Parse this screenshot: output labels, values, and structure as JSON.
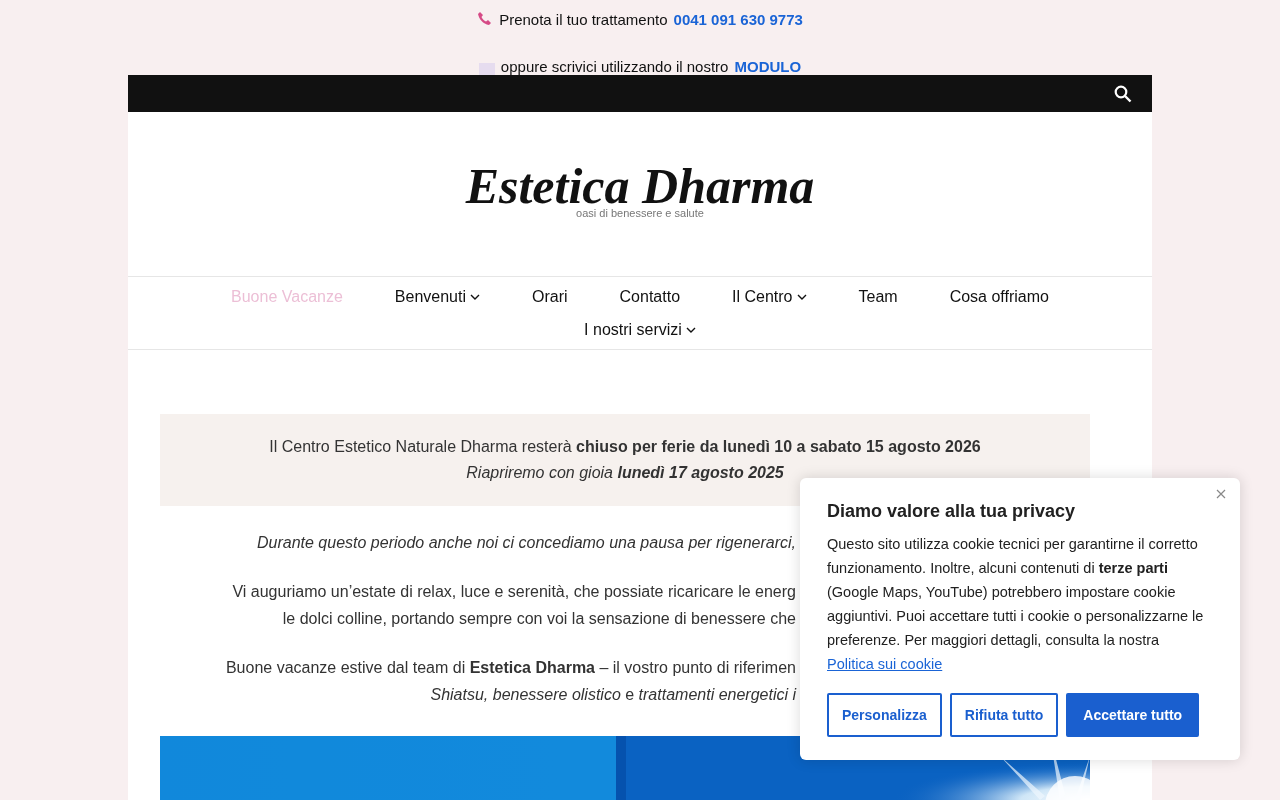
{
  "contact_bar": {
    "phone_label": "Prenota il tuo trattamento",
    "phone": "0041 091 630 9773",
    "form_label": "oppure scrivici utilizzando il nostro",
    "form_link": "MODULO"
  },
  "site": {
    "title": "Estetica Dharma",
    "tagline": "oasi di benessere e salute"
  },
  "nav": [
    {
      "label": "Buone Vacanze",
      "selected": true,
      "has_submenu": false
    },
    {
      "label": "Benvenuti",
      "selected": false,
      "has_submenu": true
    },
    {
      "label": "Orari",
      "selected": false,
      "has_submenu": false
    },
    {
      "label": "Contatto",
      "selected": false,
      "has_submenu": false
    },
    {
      "label": "Il Centro",
      "selected": false,
      "has_submenu": true
    },
    {
      "label": "Team",
      "selected": false,
      "has_submenu": false
    },
    {
      "label": "Cosa offriamo",
      "selected": false,
      "has_submenu": false
    },
    {
      "label": "I nostri servizi",
      "selected": false,
      "has_submenu": true
    }
  ],
  "notice": {
    "lines": [
      {
        "text": "Il Centro Estetico Naturale Dharma resterà **chiuso per ferie da lunedì 10 a sabato 15 agosto 2026**",
        "italic": false
      },
      {
        "text": "Riapriremo con gioia **lunedì 17 agosto 2025**",
        "italic": true
      }
    ]
  },
  "paragraphs": [
    {
      "lines": [
        {
          "text": "Durante questo periodo anche noi ci concediamo una pausa per rigenerarci,",
          "italic": true
        }
      ]
    },
    {
      "lines": [
        {
          "text": "Vi auguriamo un’estate di relax, luce e serenità, che possiate ricaricare le energ",
          "italic": false
        },
        {
          "text": "le dolci colline, portando sempre con voi la sensazione di benessere che",
          "italic": false
        }
      ]
    },
    {
      "lines": [
        {
          "text": "Buone vacanze estive dal team di **Estetica Dharma** – il vostro punto di riferimen",
          "italic": false
        },
        {
          "text": "*Shiatsu, benessere olistico* e *trattamenti energetici i*",
          "italic": false
        }
      ]
    }
  ],
  "cookie_dialog": {
    "title": "Diamo valore alla tua privacy",
    "body": "Questo sito utilizza cookie tecnici per garantirne il corretto funzionamento. Inoltre, alcuni contenuti di **terze parti** (Google Maps, YouTube) potrebbero impostare cookie aggiuntivi. Puoi accettare tutti i cookie o personalizzarne le preferenze. Per maggiori dettagli, consulta la nostra",
    "link": "Politica sui cookie",
    "buttons": [
      {
        "label": "Personalizza",
        "kind": "outline"
      },
      {
        "label": "Rifiuta tutto",
        "kind": "outline"
      },
      {
        "label": "Accettare tutto",
        "kind": "primary"
      }
    ]
  }
}
